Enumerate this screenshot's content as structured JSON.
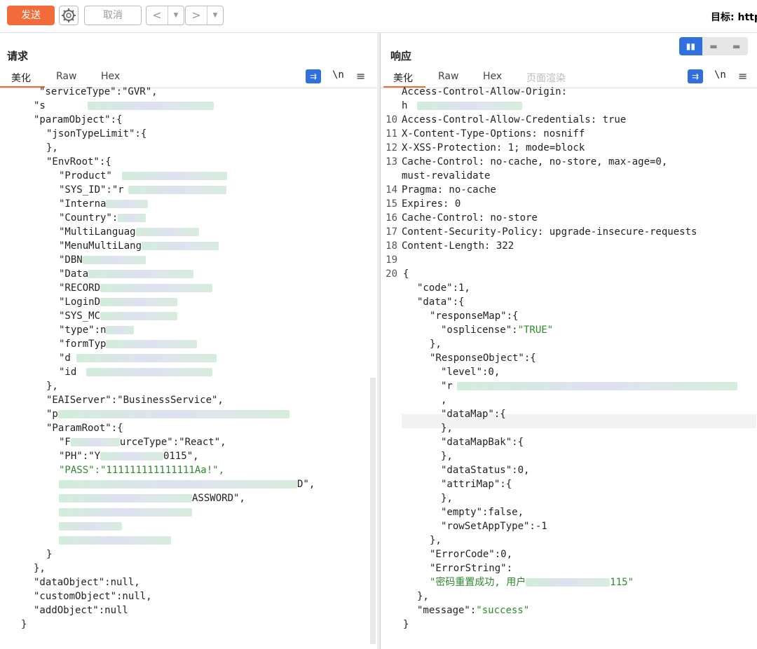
{
  "toolbar": {
    "send_label": "发送",
    "cancel_label": "取消",
    "back_label": "<",
    "forward_label": ">",
    "dropdown_label": "▼",
    "target_label": "目标: http"
  },
  "request": {
    "title": "请求",
    "tabs": [
      "美化",
      "Raw",
      "Hex"
    ],
    "tool_newline": "\\n",
    "tool_menu": "≡",
    "lines": [
      "\"serviceType\":\"GVR\",",
      "\"s",
      "\"paramObject\":{",
      "\"jsonTypeLimit\":{",
      "},",
      "\"EnvRoot\":{",
      "\"Product\"",
      "\"SYS_ID\":\"r",
      "\"Interna",
      "\"Country\":",
      "\"MultiLanguag",
      "\"MenuMultiLang",
      "\"DBN",
      "\"Data",
      "\"RECORD",
      "\"LoginD",
      "\"SYS_MC",
      "\"type\":n",
      "\"formTyp",
      "\"d",
      "\"id",
      "},",
      "\"EAIServer\":\"BusinessService\",",
      "\"p",
      "\"ParamRoot\":{",
      "\"F",
      "urceType\":\"React\",",
      "\"PH\":\"Y",
      "0115\",",
      "\"PASS\":\"111111111111111Aa!\",",
      "D\",",
      "ASSWORD\",",
      "}",
      "},",
      "\"dataObject\":null,",
      "\"customObject\":null,",
      "\"addObject\":null",
      "}"
    ]
  },
  "response": {
    "title": "响应",
    "tabs": [
      "美化",
      "Raw",
      "Hex",
      "页面渲染"
    ],
    "layout_toggle": [
      "▮▮",
      "▬",
      "▬"
    ],
    "tool_newline": "\\n",
    "tool_menu": "≡",
    "header_lines": [
      {
        "num": "",
        "text": "Access-Control-Allow-Origin:"
      },
      {
        "num": "",
        "text": "h"
      },
      {
        "num": "10",
        "text": "Access-Control-Allow-Credentials: true"
      },
      {
        "num": "11",
        "text": "X-Content-Type-Options: nosniff"
      },
      {
        "num": "12",
        "text": "X-XSS-Protection: 1; mode=block"
      },
      {
        "num": "13",
        "text": "Cache-Control: no-cache, no-store, max-age=0,"
      },
      {
        "num": "",
        "text": "must-revalidate"
      },
      {
        "num": "14",
        "text": "Pragma: no-cache"
      },
      {
        "num": "15",
        "text": "Expires: 0"
      },
      {
        "num": "16",
        "text": "Cache-Control: no-store"
      },
      {
        "num": "17",
        "text": "Content-Security-Policy: upgrade-insecure-requests"
      },
      {
        "num": "18",
        "text": "Content-Length: 322"
      },
      {
        "num": "19",
        "text": ""
      },
      {
        "num": "20",
        "text": "{"
      }
    ],
    "body_lines": [
      "\"code\":1,",
      "\"data\":{",
      "\"responseMap\":{",
      "\"osplicense\":",
      "\"TRUE\"",
      "},",
      "\"ResponseObject\":{",
      "\"level\":0,",
      "\"r",
      ",",
      "\"dataMap\":{",
      "},",
      "\"dataMapBak\":{",
      "},",
      "\"dataStatus\":0,",
      "\"attriMap\":{",
      "},",
      "\"empty\":false,",
      "\"rowSetAppType\":-1",
      "},",
      "\"ErrorCode\":0,",
      "\"ErrorString\":",
      "\"密码重置成功, 用户",
      "115\"",
      "},",
      "\"message\":",
      "\"success\"",
      "}"
    ]
  }
}
